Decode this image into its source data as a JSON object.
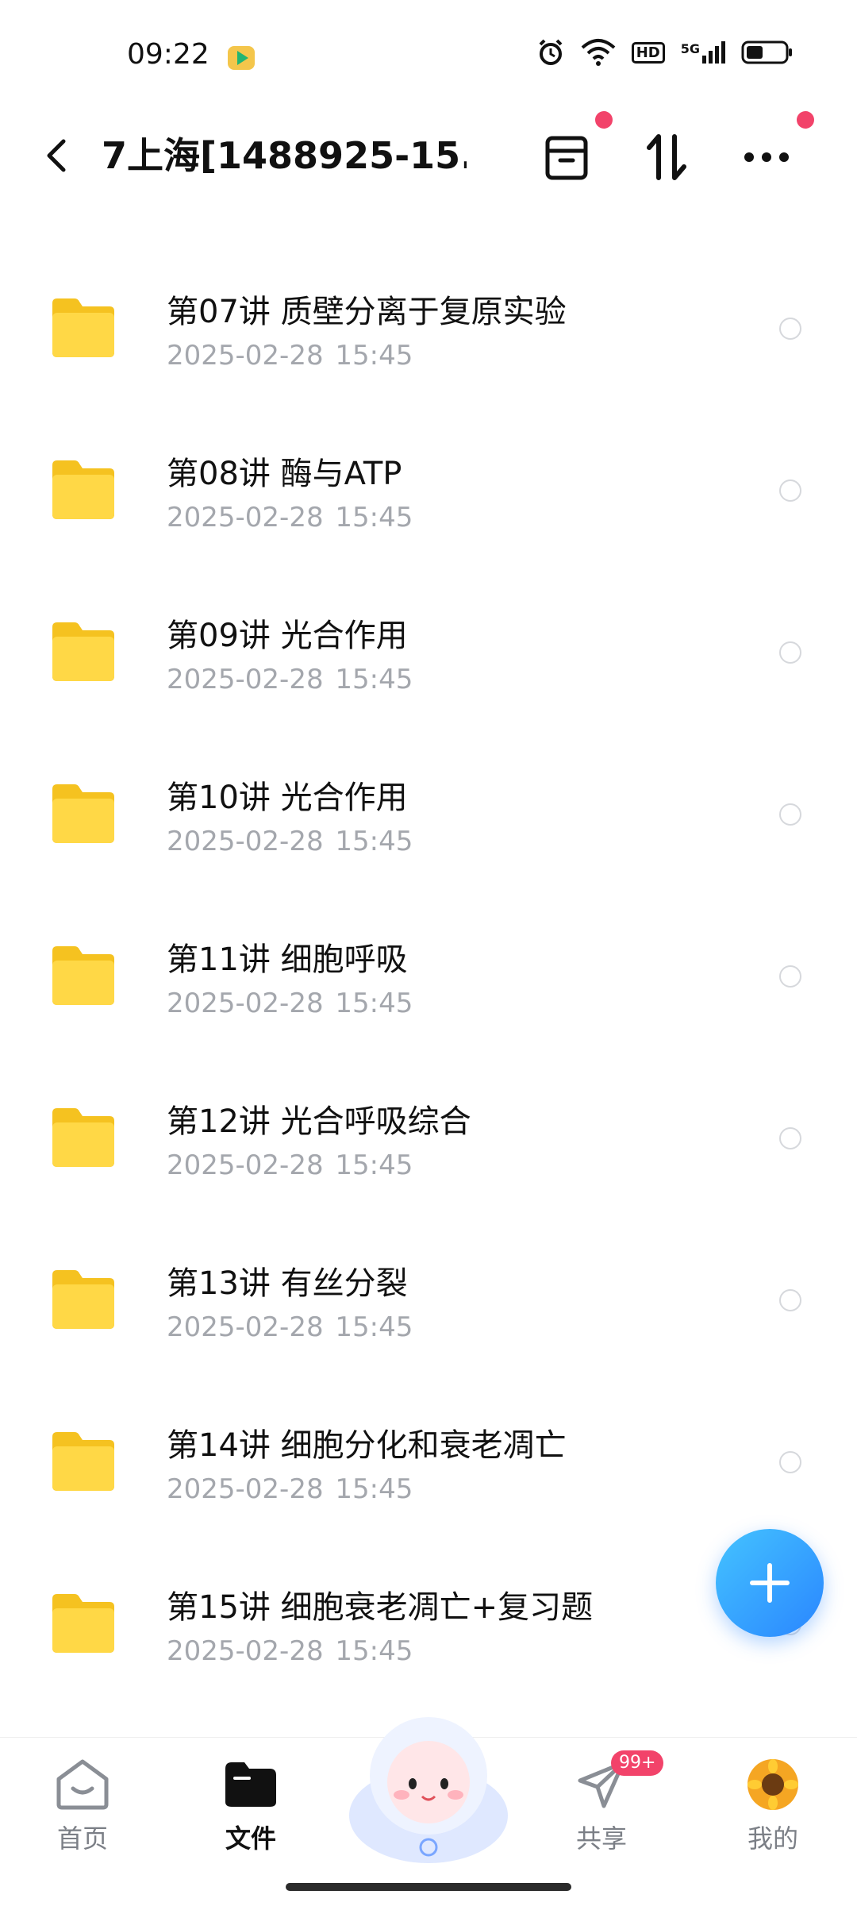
{
  "status_bar": {
    "time": "09:22",
    "network": "5G",
    "hd": "HD"
  },
  "header": {
    "title": "7上海[1488925-15..."
  },
  "files": [
    {
      "name": "第07讲 质壁分离于复原实验",
      "date": "2025-02-28  15:45"
    },
    {
      "name": "第08讲 酶与ATP",
      "date": "2025-02-28  15:45"
    },
    {
      "name": "第09讲 光合作用",
      "date": "2025-02-28  15:45"
    },
    {
      "name": "第10讲 光合作用",
      "date": "2025-02-28  15:45"
    },
    {
      "name": "第11讲 细胞呼吸",
      "date": "2025-02-28  15:45"
    },
    {
      "name": "第12讲 光合呼吸综合",
      "date": "2025-02-28  15:45"
    },
    {
      "name": "第13讲 有丝分裂",
      "date": "2025-02-28  15:45"
    },
    {
      "name": "第14讲 细胞分化和衰老凋亡",
      "date": "2025-02-28  15:45"
    },
    {
      "name": "第15讲 细胞衰老凋亡+复习题",
      "date": "2025-02-28  15:45"
    }
  ],
  "nav": {
    "home": "首页",
    "files": "文件",
    "share": "共享",
    "share_badge": "99+",
    "mine": "我的"
  },
  "colors": {
    "accent": "#2a86ff",
    "badge": "#f2436a",
    "folder": "#ffd33d"
  }
}
